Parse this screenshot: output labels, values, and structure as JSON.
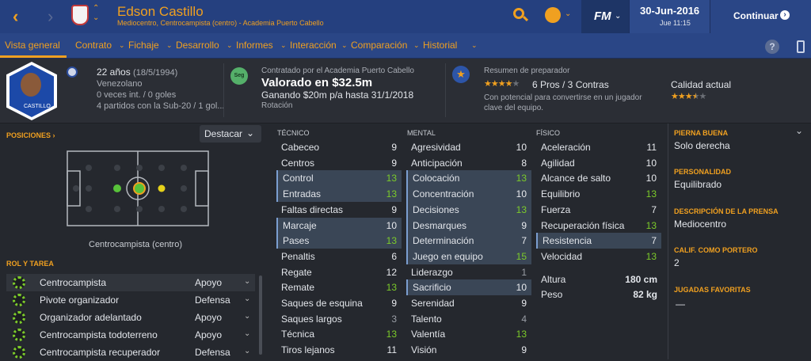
{
  "header": {
    "name": "Edson Castillo",
    "subtitle": "Mediocentro, Centrocampista (centro) - Academia Puerto Cabello",
    "date": "30-Jun-2016",
    "time": "Jue 11:15",
    "continue": "Continuar",
    "fm": "FM"
  },
  "nav": [
    "Vista general",
    "Contrato",
    "Fichaje",
    "Desarrollo",
    "Informes",
    "Interacción",
    "Comparación",
    "Historial"
  ],
  "help": "?",
  "player": {
    "age": "22 años",
    "dob": "(18/5/1994)",
    "nationality": "Venezolano",
    "caps": "0 veces int. / 0 goles",
    "youth": "4 partidos con la Sub-20 / 1 gol...",
    "shirt_name": "CASTILLO"
  },
  "contract": {
    "badge": "Seg",
    "label": "Contratado por el Academia Puerto Cabello",
    "value": "Valorado en $32.5m",
    "wage": "Ganando $20m p/a hasta 31/1/2018",
    "status": "Rotación"
  },
  "coach": {
    "title": "Resumen de preparador",
    "pros": "6 Pros / 3 Contras",
    "rating_stars": 4,
    "desc1": "Con potencial para convertirse en un jugador",
    "desc2": "clave del equipo.",
    "current_label": "Calidad actual",
    "current_stars": 3.5
  },
  "positions": {
    "title": "POSICIONES ›",
    "dropdown": "Destacar",
    "label": "Centrocampista (centro)"
  },
  "roles": {
    "title": "ROL Y TAREA",
    "items": [
      {
        "name": "Centrocampista",
        "duty": "Apoyo"
      },
      {
        "name": "Pivote organizador",
        "duty": "Defensa"
      },
      {
        "name": "Organizador adelantado",
        "duty": "Apoyo"
      },
      {
        "name": "Centrocampista todoterreno",
        "duty": "Apoyo"
      },
      {
        "name": "Centrocampista recuperador",
        "duty": "Defensa"
      }
    ]
  },
  "tecnico": {
    "title": "TÉCNICO",
    "items": [
      {
        "n": "Cabeceo",
        "v": "9"
      },
      {
        "n": "Centros",
        "v": "9"
      },
      {
        "n": "Control",
        "v": "13"
      },
      {
        "n": "Entradas",
        "v": "13"
      },
      {
        "n": "Faltas directas",
        "v": "9"
      },
      {
        "n": "Marcaje",
        "v": "10"
      },
      {
        "n": "Pases",
        "v": "13"
      },
      {
        "n": "Penaltis",
        "v": "6"
      },
      {
        "n": "Regate",
        "v": "12"
      },
      {
        "n": "Remate",
        "v": "13"
      },
      {
        "n": "Saques de esquina",
        "v": "9"
      },
      {
        "n": "Saques largos",
        "v": "3"
      },
      {
        "n": "Técnica",
        "v": "13"
      },
      {
        "n": "Tiros lejanos",
        "v": "11"
      }
    ]
  },
  "mental": {
    "title": "MENTAL",
    "items": [
      {
        "n": "Agresividad",
        "v": "10"
      },
      {
        "n": "Anticipación",
        "v": "8"
      },
      {
        "n": "Colocación",
        "v": "13"
      },
      {
        "n": "Concentración",
        "v": "10"
      },
      {
        "n": "Decisiones",
        "v": "13"
      },
      {
        "n": "Desmarques",
        "v": "9"
      },
      {
        "n": "Determinación",
        "v": "7"
      },
      {
        "n": "Juego en equipo",
        "v": "15"
      },
      {
        "n": "Liderazgo",
        "v": "1"
      },
      {
        "n": "Sacrificio",
        "v": "10"
      },
      {
        "n": "Serenidad",
        "v": "9"
      },
      {
        "n": "Talento",
        "v": "4"
      },
      {
        "n": "Valentía",
        "v": "13"
      },
      {
        "n": "Visión",
        "v": "9"
      }
    ]
  },
  "fisico": {
    "title": "FÍSICO",
    "items": [
      {
        "n": "Aceleración",
        "v": "11"
      },
      {
        "n": "Agilidad",
        "v": "10"
      },
      {
        "n": "Alcance de salto",
        "v": "10"
      },
      {
        "n": "Equilibrio",
        "v": "13"
      },
      {
        "n": "Fuerza",
        "v": "7"
      },
      {
        "n": "Recuperación física",
        "v": "13"
      },
      {
        "n": "Resistencia",
        "v": "7"
      },
      {
        "n": "Velocidad",
        "v": "13"
      }
    ],
    "height_label": "Altura",
    "height": "180 cm",
    "weight_label": "Peso",
    "weight": "82 kg"
  },
  "side": {
    "foot_label": "PIERNA BUENA",
    "foot": "Solo derecha",
    "pers_label": "PERSONALIDAD",
    "pers": "Equilibrado",
    "press_label": "DESCRIPCIÓN DE LA PRENSA",
    "press": "Mediocentro",
    "gk_label": "CALIF. COMO PORTERO",
    "gk": "2",
    "moves_label": "JUGADAS FAVORITAS",
    "moves": "—"
  }
}
